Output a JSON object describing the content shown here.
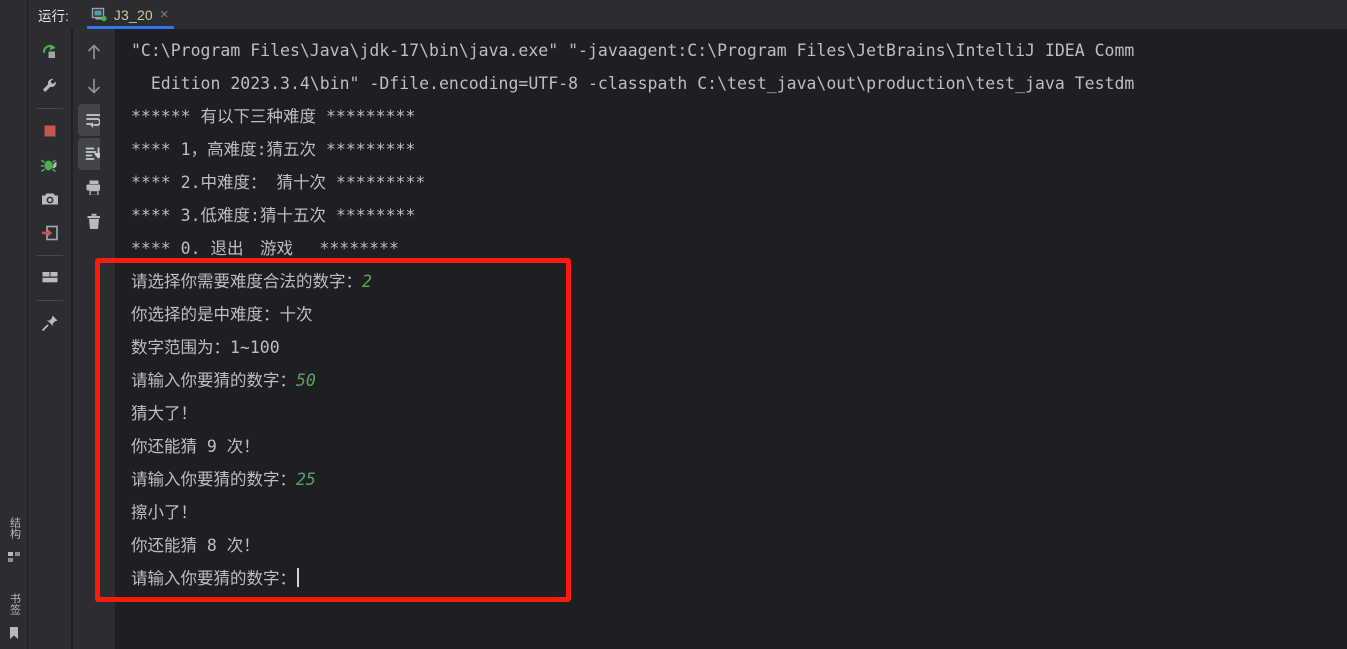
{
  "window": {
    "header": {
      "run_label": "运行:",
      "tab": {
        "name": "J3_20",
        "close": "×",
        "icon": "console-run-icon",
        "status": "running"
      }
    },
    "accent_color": "#3574f0",
    "annotation_color": "#fb1b0c",
    "console_bg": "#1e1f22",
    "panel_bg": "#2b2d30",
    "text_color": "#bcbec4",
    "user_input_color": "#5ca45c"
  },
  "left_stripe": {
    "buttons": [
      {
        "label": "结构",
        "name": "tool-window-structure"
      },
      {
        "label": "书签",
        "name": "tool-window-bookmarks"
      }
    ]
  },
  "toolbar_run": {
    "buttons": [
      {
        "name": "rerun-button",
        "title": "重新运行"
      },
      {
        "name": "settings-wrench-button",
        "title": "修改运行配置"
      },
      {
        "name": "stop-button",
        "title": "停止"
      },
      {
        "name": "attach-debugger-button",
        "title": "附加调试器"
      },
      {
        "name": "snapshot-camera-button",
        "title": "获取快照"
      },
      {
        "name": "import-exit-button",
        "title": "导入线程转储"
      },
      {
        "name": "layout-button",
        "title": "布局设置"
      },
      {
        "name": "pin-button",
        "title": "固定标签页"
      }
    ]
  },
  "toolbar_console": {
    "buttons": [
      {
        "name": "scroll-up-button",
        "title": "上一个"
      },
      {
        "name": "scroll-down-button",
        "title": "下一个"
      },
      {
        "name": "soft-wrap-button",
        "title": "软换行",
        "active": true
      },
      {
        "name": "scroll-to-end-button",
        "title": "滚动到末尾",
        "active": true
      },
      {
        "name": "print-button",
        "title": "打印"
      },
      {
        "name": "clear-all-button",
        "title": "清除全部"
      }
    ]
  },
  "console": {
    "lines": [
      {
        "id": "cmd-1",
        "text": "\"C:\\Program Files\\Java\\jdk-17\\bin\\java.exe\" \"-javaagent:C:\\Program Files\\JetBrains\\IntelliJ IDEA Comm",
        "type": "command"
      },
      {
        "id": "cmd-2",
        "text": "  Edition 2023.3.4\\bin\" -Dfile.encoding=UTF-8 -classpath C:\\test_java\\out\\production\\test_java Testdm",
        "type": "command"
      },
      {
        "id": "out-1",
        "text": "****** 有以下三种难度 *********",
        "type": "output"
      },
      {
        "id": "out-2",
        "text": "**** 1，高难度:猜五次 *********",
        "type": "output"
      },
      {
        "id": "out-3",
        "text": "**** 2.中难度： 猜十次 *********",
        "type": "output"
      },
      {
        "id": "out-4",
        "text": "**** 3.低难度:猜十五次 ********",
        "type": "output"
      },
      {
        "id": "out-5",
        "text": "**** 0. 退出　游戏　 ********",
        "type": "output"
      },
      {
        "id": "out-6",
        "prompt": "请选择你需要难度合法的数字：",
        "input": "2",
        "type": "prompt"
      },
      {
        "id": "out-7",
        "text": "你选择的是中难度：十次",
        "type": "output"
      },
      {
        "id": "out-8",
        "text": "数字范围为：1~100",
        "type": "output"
      },
      {
        "id": "out-9",
        "prompt": "请输入你要猜的数字：",
        "input": "50",
        "type": "prompt"
      },
      {
        "id": "out-10",
        "text": "猜大了！",
        "type": "output"
      },
      {
        "id": "out-11",
        "text": "你还能猜 9 次！",
        "type": "output"
      },
      {
        "id": "out-12",
        "prompt": "请输入你要猜的数字：",
        "input": "25",
        "type": "prompt"
      },
      {
        "id": "out-13",
        "text": "擦小了！",
        "type": "output"
      },
      {
        "id": "out-14",
        "text": "你还能猜 8 次！",
        "type": "output"
      },
      {
        "id": "out-15",
        "prompt": "请输入你要猜的数字：",
        "input": "",
        "type": "prompt",
        "caret": true
      }
    ]
  },
  "annotation": {
    "name": "red-highlight-box",
    "shape": "rectangle",
    "color": "#fb1b0c"
  }
}
